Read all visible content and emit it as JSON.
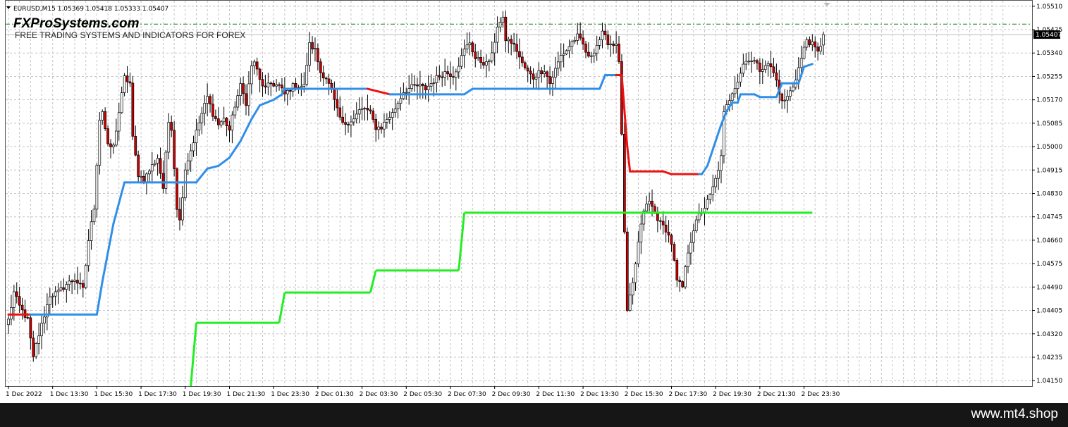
{
  "header": {
    "symbol_line": "EURUSD,M15  1.05369 1.05418 1.05333 1.05407",
    "brand": "FXProSystems.com",
    "tagline": "FREE TRADING SYSTEMS AND INDICATORS FOR FOREX"
  },
  "footer": {
    "site": "www.mt4.shop"
  },
  "colors": {
    "bull_body": "#ffffff",
    "bear_body": "#cc0000",
    "candle_outline": "#000000",
    "trend_up": "#2f8fe8",
    "trend_down": "#ee1111",
    "level_line": "#22ee22",
    "grid": "#c4c4c4",
    "current_price_bg": "#000000",
    "ask_line": "#1a7a1a"
  },
  "chart_data": {
    "type": "candlestick",
    "instrument": "EURUSD",
    "timeframe": "M15",
    "last": {
      "open": 1.05369,
      "high": 1.05418,
      "low": 1.05333,
      "close": 1.05407
    },
    "current_price_label": "1.05407",
    "ask_line_price": 1.05445,
    "ylim": [
      1.0413,
      1.0553
    ],
    "xlim": [
      0,
      295
    ],
    "grid": true,
    "y_ticks": [
      "1.05510",
      "1.05425",
      "1.05340",
      "1.05255",
      "1.05170",
      "1.05085",
      "1.05000",
      "1.04915",
      "1.04830",
      "1.04745",
      "1.04660",
      "1.04575",
      "1.04490",
      "1.04405",
      "1.04320",
      "1.04235",
      "1.04150"
    ],
    "x_ticks": [
      {
        "label": "1 Dec 2022",
        "x": 0
      },
      {
        "label": "1 Dec 13:30",
        "x": 16
      },
      {
        "label": "1 Dec 15:30",
        "x": 32
      },
      {
        "label": "1 Dec 17:30",
        "x": 48
      },
      {
        "label": "1 Dec 19:30",
        "x": 64
      },
      {
        "label": "1 Dec 21:30",
        "x": 80
      },
      {
        "label": "1 Dec 23:30",
        "x": 96
      },
      {
        "label": "2 Dec 01:30",
        "x": 112
      },
      {
        "label": "2 Dec 03:30",
        "x": 128
      },
      {
        "label": "2 Dec 05:30",
        "x": 144
      },
      {
        "label": "2 Dec 07:30",
        "x": 160
      },
      {
        "label": "2 Dec 09:30",
        "x": 176
      },
      {
        "label": "2 Dec 11:30",
        "x": 192
      },
      {
        "label": "2 Dec 13:30",
        "x": 208
      },
      {
        "label": "2 Dec 15:30",
        "x": 224
      },
      {
        "label": "2 Dec 17:30",
        "x": 240
      },
      {
        "label": "2 Dec 19:30",
        "x": 256
      },
      {
        "label": "2 Dec 21:30",
        "x": 272
      },
      {
        "label": "2 Dec 23:30",
        "x": 288
      }
    ],
    "candle_pivots": [
      [
        0,
        1.0437
      ],
      [
        2,
        1.0447
      ],
      [
        4,
        1.0442
      ],
      [
        7,
        1.0437
      ],
      [
        9,
        1.0423
      ],
      [
        10,
        1.0428
      ],
      [
        15,
        1.0446
      ],
      [
        18,
        1.0447
      ],
      [
        21,
        1.045
      ],
      [
        24,
        1.0452
      ],
      [
        27,
        1.0448
      ],
      [
        29,
        1.0466
      ],
      [
        31,
        1.0478
      ],
      [
        33,
        1.051
      ],
      [
        34,
        1.0513
      ],
      [
        36,
        1.05
      ],
      [
        38,
        1.05
      ],
      [
        42,
        1.0525
      ],
      [
        44,
        1.0523
      ],
      [
        45,
        1.0503
      ],
      [
        47,
        1.049
      ],
      [
        49,
        1.0488
      ],
      [
        52,
        1.0493
      ],
      [
        54,
        1.0496
      ],
      [
        56,
        1.0485
      ],
      [
        58,
        1.0509
      ],
      [
        59,
        1.0507
      ],
      [
        61,
        1.0478
      ],
      [
        62,
        1.0473
      ],
      [
        64,
        1.0492
      ],
      [
        67,
        1.0502
      ],
      [
        70,
        1.0512
      ],
      [
        72,
        1.0518
      ],
      [
        74,
        1.0512
      ],
      [
        76,
        1.0508
      ],
      [
        78,
        1.051
      ],
      [
        80,
        1.0506
      ],
      [
        82,
        1.0515
      ],
      [
        84,
        1.0522
      ],
      [
        86,
        1.0516
      ],
      [
        88,
        1.0529
      ],
      [
        89,
        1.0531
      ],
      [
        91,
        1.0524
      ],
      [
        93,
        1.0521
      ],
      [
        95,
        1.0523
      ],
      [
        98,
        1.0522
      ],
      [
        100,
        1.0519
      ],
      [
        103,
        1.0522
      ],
      [
        107,
        1.0522
      ],
      [
        108,
        1.053
      ],
      [
        109,
        1.0537
      ],
      [
        111,
        1.0535
      ],
      [
        113,
        1.0527
      ],
      [
        115,
        1.0525
      ],
      [
        117,
        1.052
      ],
      [
        119,
        1.0513
      ],
      [
        121,
        1.0508
      ],
      [
        123,
        1.0509
      ],
      [
        125,
        1.051
      ],
      [
        127,
        1.0513
      ],
      [
        129,
        1.0514
      ],
      [
        131,
        1.0512
      ],
      [
        133,
        1.0507
      ],
      [
        135,
        1.0507
      ],
      [
        137,
        1.051
      ],
      [
        139,
        1.0512
      ],
      [
        141,
        1.0516
      ],
      [
        143,
        1.052
      ],
      [
        145,
        1.0521
      ],
      [
        147,
        1.0522
      ],
      [
        149,
        1.0522
      ],
      [
        151,
        1.0521
      ],
      [
        153,
        1.0523
      ],
      [
        155,
        1.0525
      ],
      [
        158,
        1.0527
      ],
      [
        161,
        1.0526
      ],
      [
        163,
        1.053
      ],
      [
        165,
        1.0535
      ],
      [
        167,
        1.0538
      ],
      [
        169,
        1.0532
      ],
      [
        171,
        1.0531
      ],
      [
        173,
        1.053
      ],
      [
        175,
        1.0533
      ],
      [
        177,
        1.0544
      ],
      [
        179,
        1.0546
      ],
      [
        180,
        1.0539
      ],
      [
        182,
        1.0538
      ],
      [
        184,
        1.0535
      ],
      [
        186,
        1.053
      ],
      [
        188,
        1.0527
      ],
      [
        190,
        1.0525
      ],
      [
        192,
        1.0527
      ],
      [
        194,
        1.0528
      ],
      [
        196,
        1.0523
      ],
      [
        198,
        1.0528
      ],
      [
        200,
        1.0533
      ],
      [
        202,
        1.0535
      ],
      [
        204,
        1.0538
      ],
      [
        206,
        1.054
      ],
      [
        208,
        1.0537
      ],
      [
        210,
        1.0532
      ],
      [
        212,
        1.0535
      ],
      [
        215,
        1.0541
      ],
      [
        217,
        1.0538
      ],
      [
        219,
        1.0537
      ],
      [
        220,
        1.0538
      ],
      [
        221,
        1.053
      ],
      [
        222,
        1.0505
      ],
      [
        223,
        1.0468
      ],
      [
        224,
        1.044
      ],
      [
        226,
        1.045
      ],
      [
        228,
        1.0465
      ],
      [
        230,
        1.0477
      ],
      [
        232,
        1.048
      ],
      [
        234,
        1.0476
      ],
      [
        236,
        1.0472
      ],
      [
        238,
        1.047
      ],
      [
        240,
        1.0465
      ],
      [
        242,
        1.0451
      ],
      [
        244,
        1.0449
      ],
      [
        246,
        1.0462
      ],
      [
        248,
        1.047
      ],
      [
        250,
        1.0475
      ],
      [
        252,
        1.0478
      ],
      [
        254,
        1.0482
      ],
      [
        256,
        1.0488
      ],
      [
        258,
        1.0496
      ],
      [
        259,
        1.0512
      ],
      [
        262,
        1.052
      ],
      [
        264,
        1.0524
      ],
      [
        266,
        1.053
      ],
      [
        268,
        1.0532
      ],
      [
        270,
        1.0531
      ],
      [
        272,
        1.0528
      ],
      [
        274,
        1.053
      ],
      [
        276,
        1.0529
      ],
      [
        278,
        1.0524
      ],
      [
        280,
        1.0516
      ],
      [
        282,
        1.0518
      ],
      [
        284,
        1.0522
      ],
      [
        285,
        1.0525
      ],
      [
        287,
        1.0532
      ],
      [
        289,
        1.0539
      ],
      [
        291,
        1.0537
      ],
      [
        293,
        1.0534
      ],
      [
        295,
        1.054
      ]
    ],
    "trend_line_knots": [
      [
        0,
        1.0439,
        "dn"
      ],
      [
        8,
        1.0439,
        "dn"
      ],
      [
        9,
        1.0439,
        "up"
      ],
      [
        32,
        1.0439,
        "up"
      ],
      [
        34,
        1.0451,
        "up"
      ],
      [
        38,
        1.0472,
        "up"
      ],
      [
        42,
        1.0487,
        "up"
      ],
      [
        68,
        1.0487,
        "up"
      ],
      [
        72,
        1.0492,
        "up"
      ],
      [
        76,
        1.0493,
        "up"
      ],
      [
        80,
        1.0496,
        "up"
      ],
      [
        84,
        1.0502,
        "up"
      ],
      [
        88,
        1.051,
        "up"
      ],
      [
        91,
        1.0515,
        "up"
      ],
      [
        96,
        1.0517,
        "up"
      ],
      [
        99,
        1.0519,
        "up"
      ],
      [
        100,
        1.0521,
        "up"
      ],
      [
        108,
        1.0521,
        "up"
      ],
      [
        109,
        1.0521,
        "up"
      ],
      [
        130,
        1.0521,
        "up"
      ],
      [
        134,
        1.052,
        "dn"
      ],
      [
        138,
        1.0519,
        "dn"
      ],
      [
        139,
        1.0519,
        "up"
      ],
      [
        165,
        1.0519,
        "up"
      ],
      [
        168,
        1.0521,
        "up"
      ],
      [
        214,
        1.0521,
        "up"
      ],
      [
        216,
        1.0526,
        "up"
      ],
      [
        220,
        1.0526,
        "up"
      ],
      [
        221,
        1.0526,
        "dn"
      ],
      [
        222,
        1.0526,
        "dn"
      ],
      [
        224,
        1.05,
        "dn"
      ],
      [
        225,
        1.0491,
        "dn"
      ],
      [
        237,
        1.0491,
        "dn"
      ],
      [
        240,
        1.049,
        "dn"
      ],
      [
        250,
        1.049,
        "dn"
      ],
      [
        251,
        1.049,
        "up"
      ],
      [
        253,
        1.0493,
        "up"
      ],
      [
        256,
        1.0502,
        "up"
      ],
      [
        258,
        1.0508,
        "up"
      ],
      [
        260,
        1.0513,
        "up"
      ],
      [
        262,
        1.0516,
        "up"
      ],
      [
        264,
        1.0516,
        "up"
      ],
      [
        265,
        1.0519,
        "up"
      ],
      [
        270,
        1.0519,
        "up"
      ],
      [
        272,
        1.0518,
        "up"
      ],
      [
        278,
        1.0518,
        "up"
      ],
      [
        280,
        1.0523,
        "up"
      ],
      [
        286,
        1.0523,
        "up"
      ],
      [
        288,
        1.0529,
        "up"
      ],
      [
        291,
        1.053,
        "up"
      ]
    ],
    "level_line_knots": [
      [
        66,
        1.0413
      ],
      [
        68,
        1.0436
      ],
      [
        98,
        1.0436
      ],
      [
        100,
        1.0447
      ],
      [
        131,
        1.0447
      ],
      [
        133,
        1.0455
      ],
      [
        163,
        1.0455
      ],
      [
        165,
        1.0476
      ],
      [
        291,
        1.0476
      ]
    ]
  }
}
